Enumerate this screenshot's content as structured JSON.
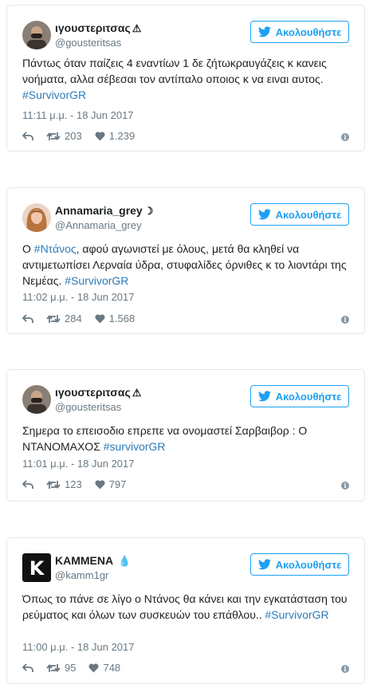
{
  "follow_label": "Ακολουθήστε",
  "tweets": [
    {
      "name": "ιγουστεριτσας",
      "badge": "⚠",
      "handle": "@gousteritsas",
      "text_before": "Πάντως όταν παίζεις 4 εναντίων 1 δε ζήτωκραυγάζεις κ κανεις νοήματα, αλλα σέβεσαι τον αντίπαλο οποιος κ να ειναι αυτος. ",
      "hashtag": "#SurvivorGR",
      "text_after": "",
      "time": "11:11 μ.μ. - 18 Jun 2017",
      "retweets": "203",
      "likes": "1.239"
    },
    {
      "name": "Annamaria_grey",
      "badge": "☽",
      "handle": "@Annamaria_grey",
      "text_before": "Ο ",
      "hashtag": "#Ντάνος",
      "text_after": ", αφού αγωνιστεί με όλους, μετά θα κληθεί να αντιμετωπίσει Λερναία ύδρα, στυφαλίδες όρνιθες κ το λιοντάρι της Νεμέας. ",
      "hashtag2": "#SurvivorGR",
      "time": "11:02 μ.μ. - 18 Jun 2017",
      "retweets": "284",
      "likes": "1.568"
    },
    {
      "name": "ιγουστεριτσας",
      "badge": "⚠",
      "handle": "@gousteritsas",
      "text_before": "Σημερα το επεισοδιο επρεπε να ονομαστεί Σαρβαιβορ : Ο ΝΤΑΝΟΜΑΧΟΣ ",
      "hashtag": "#survivorGR",
      "text_after": "",
      "time": "11:01 μ.μ. - 18 Jun 2017",
      "retweets": "123",
      "likes": "797"
    },
    {
      "name": "ΚΑΜΜΕΝΑ",
      "badge": "💧",
      "handle": "@kamm1gr",
      "text_before": "Όπως το πάνε σε λίγο ο Ντάνος θα κάνει και την εγκατάσταση του ρεύματος και όλων των συσκευών του επάθλου.. ",
      "hashtag": "#SurvivorGR",
      "text_after": "",
      "time": "11:00 μ.μ. - 18 Jun 2017",
      "retweets": "95",
      "likes": "748",
      "avatar_letter": "K"
    }
  ]
}
